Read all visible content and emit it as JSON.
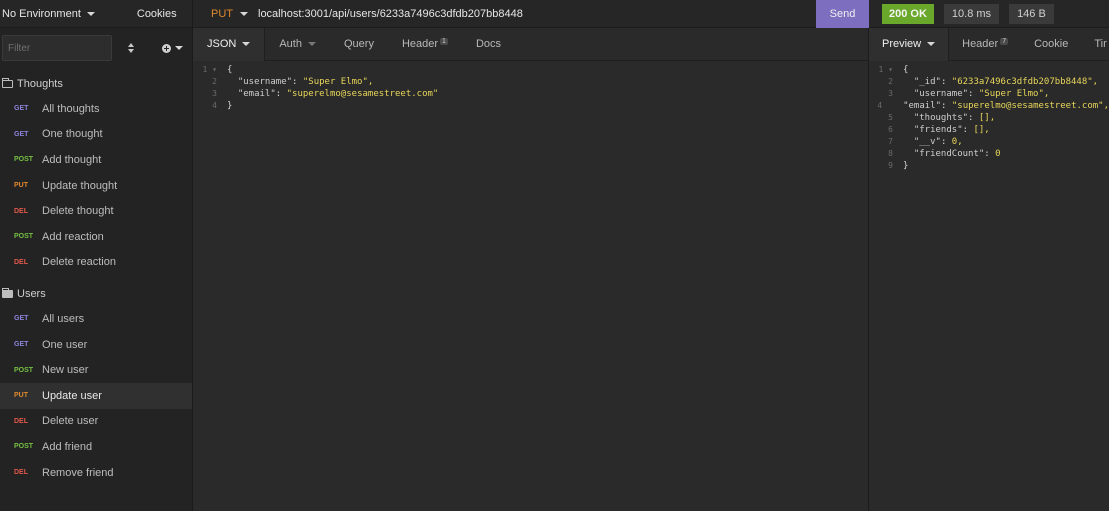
{
  "env": {
    "label": "No Environment",
    "cookies": "Cookies"
  },
  "sidebar": {
    "filter_placeholder": "Filter",
    "groups": [
      {
        "name": "Thoughts",
        "items": [
          {
            "method": "GET",
            "label": "All thoughts"
          },
          {
            "method": "GET",
            "label": "One thought"
          },
          {
            "method": "POST",
            "label": "Add thought"
          },
          {
            "method": "PUT",
            "label": "Update thought"
          },
          {
            "method": "DEL",
            "label": "Delete thought"
          },
          {
            "method": "POST",
            "label": "Add reaction"
          },
          {
            "method": "DEL",
            "label": "Delete reaction"
          }
        ]
      },
      {
        "name": "Users",
        "items": [
          {
            "method": "GET",
            "label": "All users"
          },
          {
            "method": "GET",
            "label": "One user"
          },
          {
            "method": "POST",
            "label": "New user"
          },
          {
            "method": "PUT",
            "label": "Update user"
          },
          {
            "method": "DEL",
            "label": "Delete user"
          },
          {
            "method": "POST",
            "label": "Add friend"
          },
          {
            "method": "DEL",
            "label": "Remove friend"
          }
        ]
      }
    ]
  },
  "request": {
    "method": "PUT",
    "url": "localhost:3001/api/users/6233a7496c3dfdb207bb8448",
    "send_label": "Send",
    "tabs": [
      {
        "label": "JSON"
      },
      {
        "label": "Auth"
      },
      {
        "label": "Query"
      },
      {
        "label": "Header",
        "badge": "1"
      },
      {
        "label": "Docs"
      }
    ],
    "body_lines": [
      "{",
      "  \"username\": \"Super Elmo\",",
      "  \"email\": \"superelmo@sesamestreet.com\"",
      "}"
    ]
  },
  "response": {
    "status": "200 OK",
    "time": "10.8 ms",
    "size": "146 B",
    "tabs": [
      {
        "label": "Preview"
      },
      {
        "label": "Header",
        "badge": "7"
      },
      {
        "label": "Cookie"
      },
      {
        "label": "Timeline"
      }
    ],
    "body_lines": [
      "{",
      "  \"_id\": \"6233a7496c3dfdb207bb8448\",",
      "  \"username\": \"Super Elmo\",",
      "  \"email\": \"superelmo@sesamestreet.com\",",
      "  \"thoughts\": [],",
      "  \"friends\": [],",
      "  \"__v\": 0,",
      "  \"friendCount\": 0",
      "}"
    ]
  },
  "colors": {
    "get": "#8b84d9",
    "post": "#74c043",
    "put": "#e0882e",
    "del": "#e2584b",
    "send": "#7d6ec0",
    "status_ok": "#6aa82c"
  }
}
